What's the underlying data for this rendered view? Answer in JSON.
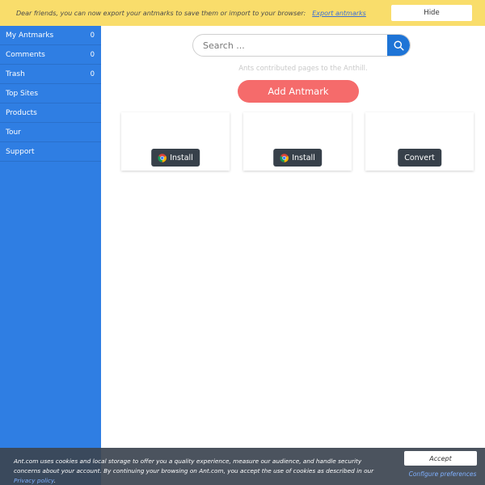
{
  "notice": {
    "message": "Dear friends, you can now export your antmarks to save them or import to your browser:",
    "link": "Export antmarks",
    "hide_label": "Hide"
  },
  "sidebar": {
    "items": [
      {
        "label": "My Antmarks",
        "count": "0"
      },
      {
        "label": "Comments",
        "count": "0"
      },
      {
        "label": "Trash",
        "count": "0"
      },
      {
        "label": "Top Sites",
        "count": ""
      },
      {
        "label": "Products",
        "count": ""
      },
      {
        "label": "Tour",
        "count": ""
      },
      {
        "label": "Support",
        "count": ""
      }
    ]
  },
  "search": {
    "placeholder": "Search ..."
  },
  "tagline": "Ants contributed pages to the Anthill.",
  "add_label": "Add Antmark",
  "cards": [
    {
      "button": "Install"
    },
    {
      "button": "Install"
    },
    {
      "button": "Convert"
    }
  ],
  "cookie": {
    "message": "Ant.com uses cookies and local storage to offer you a quality experience, measure our audience, and handle security concerns about your account. By continuing your browsing on Ant.com, you accept the use of cookies as described in our",
    "policy_link": "Privacy policy",
    "accept_label": "Accept",
    "config_label": "Configure preferences"
  },
  "colors": {
    "sidebar": "#2f7ee3",
    "notice": "#f9dd6b",
    "accent": "#1e74d6",
    "add_button": "#f56b6b",
    "card_button": "#37404a"
  },
  "icons": {
    "search": "search-icon",
    "browser": "chrome-icon"
  }
}
